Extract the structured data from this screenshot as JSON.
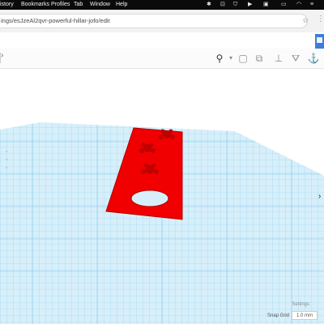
{
  "menubar": {
    "items": [
      "istory",
      "Bookmarks",
      "Profiles",
      "Tab",
      "Window",
      "Help"
    ]
  },
  "browser": {
    "url": "ings/esJzeAl2qvr-powerful-hillar-jofo/edit"
  },
  "workplane": {
    "grid_color": "#6fc3e6",
    "background_color": "#ffffff"
  },
  "object": {
    "color": "#f00000"
  },
  "footer": {
    "settings_label": "Settings",
    "snap_grid_label": "Snap Grid",
    "snap_grid_value": "1.0 mm"
  },
  "icons": {
    "lightbulb": "lightbulb-icon",
    "grid": "grid-icon"
  }
}
